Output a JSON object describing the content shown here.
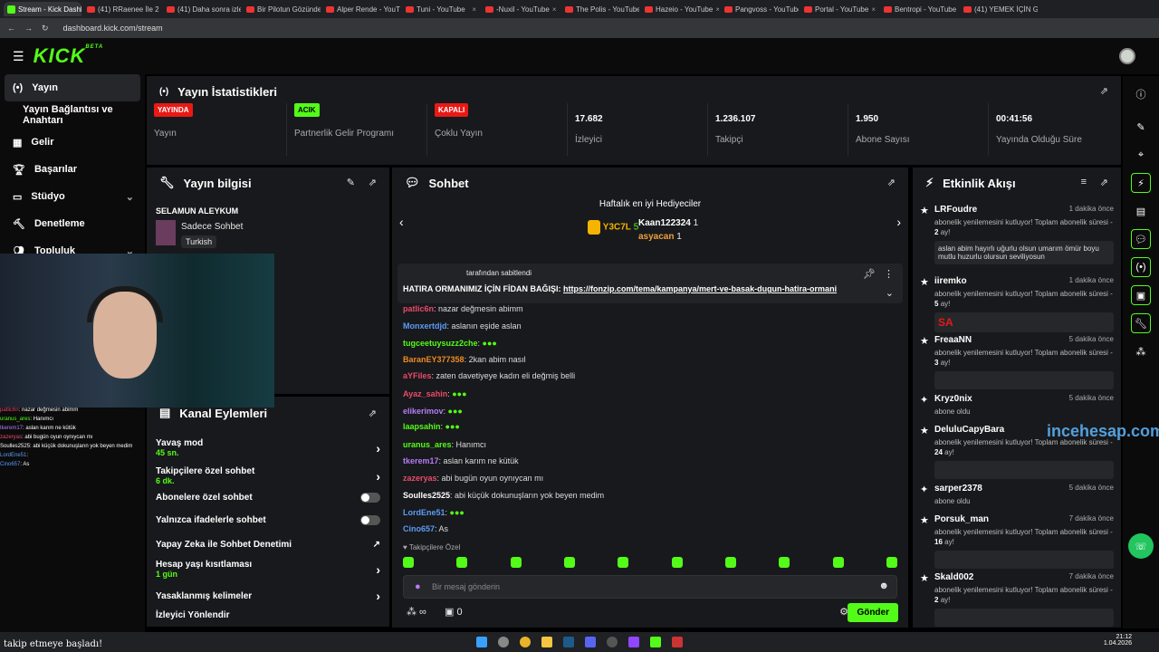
{
  "tabs": [
    "Stream - Kick Dashb",
    "(41) RRaenee İle 2 S",
    "(41) Daha sonra izle",
    "Bir Pilotun Gözünden",
    "Alper Rende - YouT",
    "Tuni - YouTube",
    "-Nuxil - YouTube",
    "The Polis - YouTube",
    "Hazeio - YouTube",
    "Pangvoss - YouTube",
    "Portal - YouTube",
    "Bentropi - YouTube",
    "(41) YEMEK İÇİN G"
  ],
  "url": "dashboard.kick.com/stream",
  "logo": "KICK",
  "logo_badge": "BETA",
  "sidebar": [
    {
      "label": "Yayın",
      "icon": "broadcast-icon"
    },
    {
      "label": "Yayın Bağlantısı ve Anahtarı",
      "icon": ""
    },
    {
      "label": "Gelir",
      "icon": "chart-icon"
    },
    {
      "label": "Başarılar",
      "icon": "trophy-icon"
    },
    {
      "label": "Stüdyo",
      "icon": "studio-icon"
    },
    {
      "label": "Denetleme",
      "icon": "hammer-icon"
    },
    {
      "label": "Topluluk",
      "icon": "people-icon"
    }
  ],
  "stats": {
    "title": "Yayın İstatistikleri",
    "items": [
      {
        "badge": "YAYINDA",
        "badge_color": "#e91916",
        "label": "Yayın"
      },
      {
        "badge": "ACIK",
        "badge_color": "#53fc18",
        "label": "Partnerlik Gelir Programı"
      },
      {
        "badge": "KAPALI",
        "badge_color": "#e91916",
        "label": "Çoklu Yayın"
      },
      {
        "value": "17.682",
        "label": "İzleyici"
      },
      {
        "value": "1.236.107",
        "label": "Takipçi"
      },
      {
        "value": "1.950",
        "label": "Abone Sayısı"
      },
      {
        "value": "00:41:56",
        "label": "Yayında Olduğu Süre"
      }
    ]
  },
  "info": {
    "title": "Yayın bilgisi",
    "stream_title": "SELAMUN ALEYKUM",
    "category": "Sadece Sohbet",
    "language": "Turkish"
  },
  "channel": {
    "title": "Kanal Eylemleri",
    "rows": [
      {
        "label": "Yavaş mod",
        "sub": "45 sn.",
        "control": "chevron"
      },
      {
        "label": "Takipçilere özel sohbet",
        "sub": "6 dk.",
        "control": "chevron"
      },
      {
        "label": "Abonelere özel sohbet",
        "sub": "",
        "control": "toggle"
      },
      {
        "label": "Yalnızca ifadelerle sohbet",
        "sub": "",
        "control": "toggle"
      },
      {
        "label": "Yapay Zeka ile Sohbet Denetimi",
        "sub": "",
        "control": "external"
      },
      {
        "label": "Hesap yaşı kısıtlaması",
        "sub": "1 gün",
        "control": "chevron"
      },
      {
        "label": "Yasaklanmış kelimeler",
        "sub": "",
        "control": "chevron"
      },
      {
        "label": "İzleyici Yönlendir",
        "sub": "",
        "control": ""
      }
    ]
  },
  "chat": {
    "title": "Sohbet",
    "gifters_title": "Haftalık en iyi Hediyeciler",
    "gifter1": "Y3C7L",
    "gifter1_count": "5",
    "gifter2": "Kaan122324",
    "gifter2_count": "1",
    "gifter3": "asyacan",
    "gifter3_count": "1",
    "pinned_by": "tarafından sabitlendi",
    "pinned_text": "HATIRA ORMANIMIZ İÇİN FİDAN BAĞIŞI:",
    "pinned_link": "https://fonzip.com/tema/kampanya/mert-ve-basak-dugun-hatira-ormani",
    "messages": [
      {
        "user": "patlic6n",
        "color": "#e94b6a",
        "text": "nazar değmesin abimm"
      },
      {
        "user": "Monxertdjd",
        "color": "#5b9cf5",
        "text": "aslanın eşide aslan"
      },
      {
        "user": "tugceetuysuzz2che",
        "color": "#53fc18",
        "text": ""
      },
      {
        "user": "BaranEY377358",
        "color": "#f08a24",
        "text": "2kan abim nasıl"
      },
      {
        "user": "aYFiles",
        "color": "#e94b6a",
        "text": "zaten davetiyeye kadın eli değmiş belli"
      },
      {
        "user": "Ayaz_sahin",
        "color": "#e94b6a",
        "text": ""
      },
      {
        "user": "elikerimov",
        "color": "#b57cf5",
        "text": ""
      },
      {
        "user": "laapsahin",
        "color": "#53fc18",
        "text": ""
      },
      {
        "user": "uranus_ares",
        "color": "#53fc18",
        "text": "Hanımcı"
      },
      {
        "user": "tkerem17",
        "color": "#b57cf5",
        "text": "aslan karım ne kütük"
      },
      {
        "user": "zazeryas",
        "color": "#e94b6a",
        "text": "abi bugün oyun oynıycan mı"
      },
      {
        "user": "Soulles2525",
        "color": "#ffffff",
        "text": "abi küçük dokunuşların yok beyen medim"
      },
      {
        "user": "LordEne51",
        "color": "#5b9cf5",
        "text": ""
      },
      {
        "user": "Cino657",
        "color": "#5b9cf5",
        "text": "As"
      }
    ],
    "followers_only": "Takipçilere Özel",
    "input_placeholder": "Bir mesaj gönderin",
    "send": "Gönder",
    "count": "0"
  },
  "activity": {
    "title": "Etkinlik Akışı",
    "events": [
      {
        "name": "LRFoudre",
        "time": "1 dakika önce",
        "desc": "abonelik yenilemesini kutluyor! Toplam abonelik süresi",
        "months": "2",
        "note": "aslan abim hayırlı uğurlu olsun umarım ömür boyu mutlu huzurlu olursun seviliyosun"
      },
      {
        "name": "iiremko",
        "time": "1 dakika önce",
        "desc": "abonelik yenilemesini kutluyor! Toplam abonelik süresi",
        "months": "5",
        "note": "SA"
      },
      {
        "name": "FreaaNN",
        "time": "5 dakika önce",
        "desc": "abonelik yenilemesini kutluyor! Toplam abonelik süresi",
        "months": "3",
        "note": ""
      },
      {
        "name": "Kryz0nix",
        "time": "5 dakika önce",
        "desc": "abone oldu",
        "months": "",
        "note": null
      },
      {
        "name": "DeluluCapyBara",
        "time": "",
        "desc": "abonelik yenilemesini kutluyor! Toplam abonelik süresi",
        "months": "24",
        "note": ""
      },
      {
        "name": "sarper2378",
        "time": "5 dakika önce",
        "desc": "abone oldu",
        "months": "",
        "note": null
      },
      {
        "name": "Porsuk_man",
        "time": "7 dakika önce",
        "desc": "abonelik yenilemesini kutluyor! Toplam abonelik süresi",
        "months": "16",
        "note": ""
      },
      {
        "name": "Skald002",
        "time": "7 dakika önce",
        "desc": "abonelik yenilemesini kutluyor! Toplam abonelik süresi",
        "months": "2",
        "note": ""
      }
    ]
  },
  "months_suffix": "ay!",
  "watermark": "incehesap.com",
  "overlay_text": "takip etmeye başladı!",
  "clock": {
    "time": "21:12",
    "date": "1.04.2026"
  }
}
